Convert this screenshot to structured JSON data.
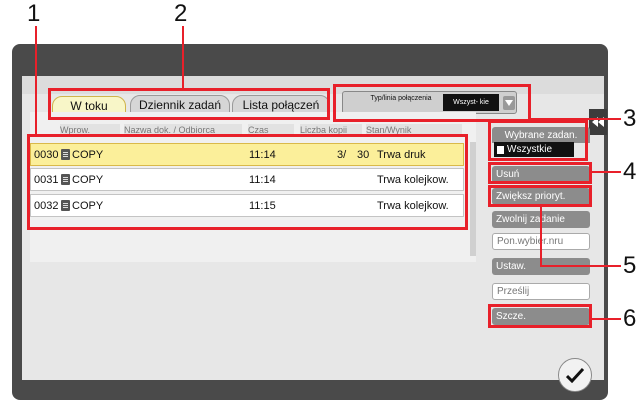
{
  "callouts": [
    "1",
    "2",
    "3",
    "4",
    "5",
    "6"
  ],
  "tabs": [
    {
      "label": "W toku",
      "active": true
    },
    {
      "label": "Dziennik zadań",
      "active": false
    },
    {
      "label": "Lista połączeń",
      "active": false
    }
  ],
  "type_selector": {
    "label": "Typ/linia połączenia",
    "selected": "Wszyst- kie"
  },
  "columns": [
    "Wprow.",
    "Nazwa dok. / Odbiorca",
    "Czas",
    "Liczba kopii",
    "Stan/Wynik"
  ],
  "jobs": [
    {
      "num": "0030",
      "name": "COPY",
      "time": "11:14",
      "copies": "3/",
      "total": "30",
      "status": "Trwa druk",
      "selected": true
    },
    {
      "num": "0031",
      "name": "COPY",
      "time": "11:14",
      "copies": "",
      "total": "",
      "status": "Trwa kolejkow.",
      "selected": false
    },
    {
      "num": "0032",
      "name": "COPY",
      "time": "11:15",
      "copies": "",
      "total": "",
      "status": "Trwa kolejkow.",
      "selected": false
    }
  ],
  "right_panel": {
    "selected_jobs_label": "Wybrane zadan.",
    "all_label": "Wszystkie",
    "buttons": [
      {
        "label": "Usuń",
        "enabled": true
      },
      {
        "label": "Zwiększ prioryt.",
        "enabled": true
      },
      {
        "label": "Zwolnij zadanie",
        "enabled": true
      },
      {
        "label": "Pon.wybier.nru",
        "enabled": false
      },
      {
        "label": "Ustaw.",
        "enabled": true
      },
      {
        "label": "Prześlij",
        "enabled": false
      },
      {
        "label": "Szcze.",
        "enabled": true
      }
    ]
  },
  "icons": {
    "rewind": "rewind-icon",
    "confirm": "checkmark-icon",
    "document": "document-icon"
  },
  "colors": {
    "callout": "#e8202a",
    "selected_row": "#fbef9a",
    "active_tab": "#f8f6c8"
  }
}
